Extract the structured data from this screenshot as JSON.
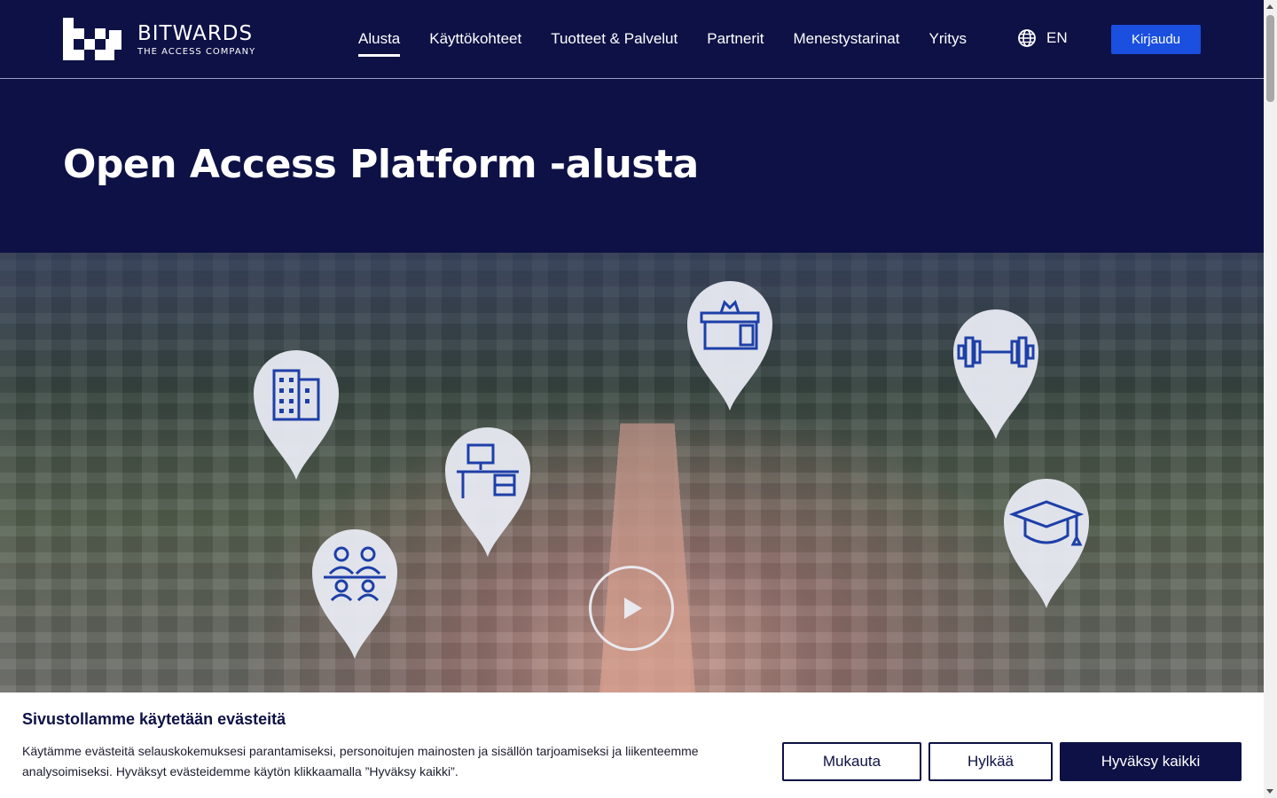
{
  "brand": {
    "name": "BITWARDS",
    "tagline": "THE ACCESS COMPANY"
  },
  "nav": {
    "items": [
      {
        "label": "Alusta",
        "active": true
      },
      {
        "label": "Käyttökohteet",
        "active": false
      },
      {
        "label": "Tuotteet & Palvelut",
        "active": false
      },
      {
        "label": "Partnerit",
        "active": false
      },
      {
        "label": "Menestystarinat",
        "active": false
      },
      {
        "label": "Yritys",
        "active": false
      }
    ],
    "language": "EN",
    "login_label": "Kirjaudu"
  },
  "hero": {
    "title": "Open Access Platform -alusta"
  },
  "video": {
    "pin_icons": [
      "office-building-icon",
      "desk-icon",
      "meeting-room-icon",
      "reception-desk-icon",
      "gym-dumbbell-icon",
      "graduation-cap-icon"
    ]
  },
  "cookie": {
    "title": "Sivustollamme käytetään evästeitä",
    "text": "Käytämme evästeitä selauskokemuksesi parantamiseksi, personoitujen mainosten ja sisällön tarjoamiseksi ja liikenteemme analysoimiseksi. Hyväksyt evästeidemme käytön klikkaamalla ”Hyväksy kaikki”.",
    "customize_label": "Mukauta",
    "reject_label": "Hylkää",
    "accept_label": "Hyväksy kaikki"
  },
  "colors": {
    "navy": "#0d1145",
    "accent_blue": "#1a4fe0",
    "icon_blue": "#1d3fa8"
  }
}
